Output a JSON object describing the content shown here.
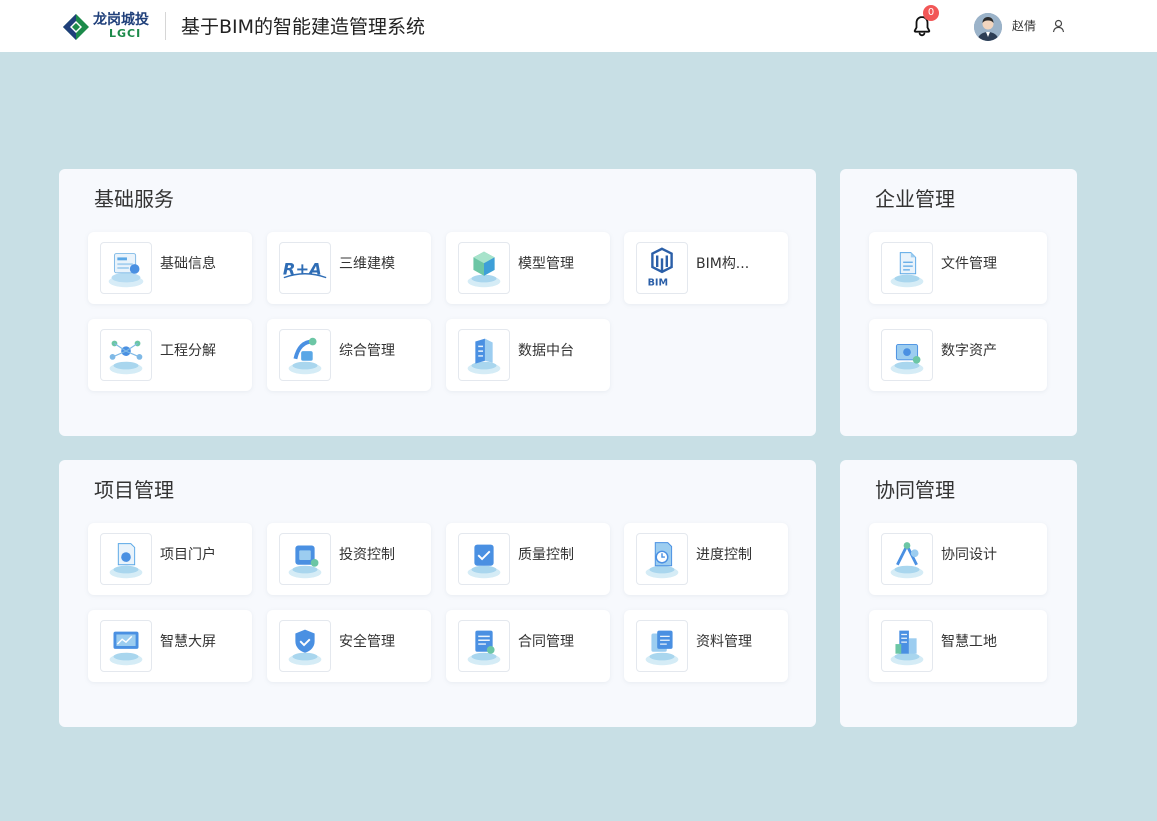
{
  "header": {
    "logo_cn": "龙岗城投",
    "logo_en": "LGCI",
    "title": "基于BIM的智能建造管理系统",
    "notification_count": "0",
    "username": "赵倩"
  },
  "icons": {
    "bell": "bell-icon",
    "user": "user-icon",
    "avatar": "avatar"
  },
  "colors": {
    "background": "#c8dfe5",
    "panel": "#f7f9fd",
    "badge": "#f25757",
    "accent": "#4a90e2"
  },
  "panels": {
    "basic": {
      "title": "基础服务",
      "items": [
        {
          "label": "基础信息",
          "icon": "info-screen-icon"
        },
        {
          "label": "三维建模",
          "icon": "rta-logo-icon"
        },
        {
          "label": "模型管理",
          "icon": "model-cube-icon"
        },
        {
          "label": "BIM构...",
          "icon": "bim-logo-icon"
        },
        {
          "label": "工程分解",
          "icon": "network-icon"
        },
        {
          "label": "综合管理",
          "icon": "management-icon"
        },
        {
          "label": "数据中台",
          "icon": "data-platform-icon"
        }
      ]
    },
    "enterprise": {
      "title": "企业管理",
      "items": [
        {
          "label": "文件管理",
          "icon": "file-icon"
        },
        {
          "label": "数字资产",
          "icon": "digital-asset-icon"
        }
      ]
    },
    "project": {
      "title": "项目管理",
      "items": [
        {
          "label": "项目门户",
          "icon": "portal-icon"
        },
        {
          "label": "投资控制",
          "icon": "investment-icon"
        },
        {
          "label": "质量控制",
          "icon": "quality-icon"
        },
        {
          "label": "进度控制",
          "icon": "progress-icon"
        },
        {
          "label": "智慧大屏",
          "icon": "big-screen-icon"
        },
        {
          "label": "安全管理",
          "icon": "safety-shield-icon"
        },
        {
          "label": "合同管理",
          "icon": "contract-icon"
        },
        {
          "label": "资料管理",
          "icon": "documents-icon"
        }
      ]
    },
    "collab": {
      "title": "协同管理",
      "items": [
        {
          "label": "协同设计",
          "icon": "collab-design-icon"
        },
        {
          "label": "智慧工地",
          "icon": "smart-site-icon"
        }
      ]
    }
  }
}
